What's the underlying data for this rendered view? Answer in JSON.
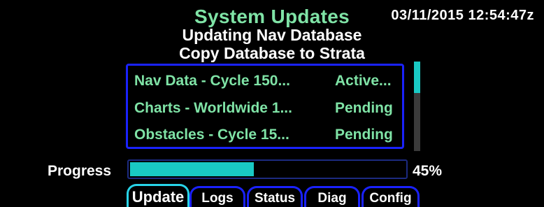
{
  "header": {
    "title": "System Updates",
    "datetime": "03/11/2015 12:54:47z",
    "subtitle_line1": "Updating Nav Database",
    "subtitle_line2": "Copy Database to Strata"
  },
  "update_list": {
    "items": [
      {
        "name": "Nav Data - Cycle 150...",
        "status": "Active..."
      },
      {
        "name": "Charts - Worldwide 1...",
        "status": "Pending"
      },
      {
        "name": "Obstacles - Cycle 15...",
        "status": "Pending"
      }
    ]
  },
  "progress": {
    "label": "Progress",
    "value": 45,
    "percent_text": "45%"
  },
  "tabs": [
    {
      "label": "Update",
      "active": true
    },
    {
      "label": "Logs",
      "active": false
    },
    {
      "label": "Status",
      "active": false
    },
    {
      "label": "Diag",
      "active": false
    },
    {
      "label": "Config",
      "active": false
    }
  ],
  "colors": {
    "title": "#7fe3a6",
    "list_text": "#7fe3a6",
    "border_blue": "#1a22ff",
    "accent_cyan": "#19c9c4",
    "active_tab": "#28d4e8"
  }
}
